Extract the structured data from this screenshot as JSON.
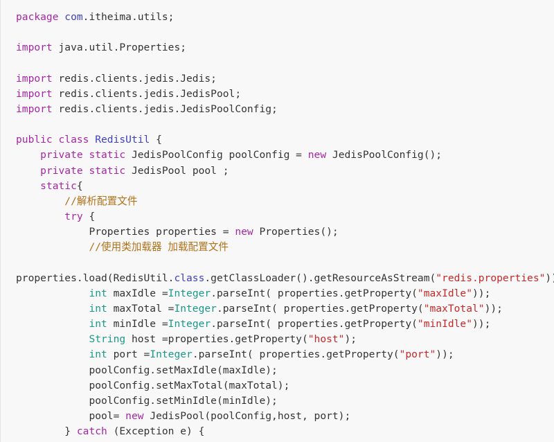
{
  "editor": {
    "language": "java",
    "background_color": "#f8f8f8",
    "text_color": "#333333",
    "theme_colors": {
      "keyword": "#a626a4",
      "type": "#1a9988",
      "class_name": "#4040c0",
      "string": "#c62828",
      "comment": "#b07219",
      "plain": "#333333"
    }
  },
  "code": {
    "lines": [
      {
        "indent": 0,
        "tokens": [
          {
            "t": "package ",
            "c": "kw"
          },
          {
            "t": "com",
            "c": "cls"
          },
          {
            "t": ".itheima.utils;",
            "c": "pln"
          }
        ]
      },
      {
        "indent": 0,
        "tokens": []
      },
      {
        "indent": 0,
        "tokens": [
          {
            "t": "import ",
            "c": "kw"
          },
          {
            "t": "java.util.Properties;",
            "c": "pln"
          }
        ]
      },
      {
        "indent": 0,
        "tokens": []
      },
      {
        "indent": 0,
        "tokens": [
          {
            "t": "import ",
            "c": "kw"
          },
          {
            "t": "redis.clients.jedis.Jedis;",
            "c": "pln"
          }
        ]
      },
      {
        "indent": 0,
        "tokens": [
          {
            "t": "import ",
            "c": "kw"
          },
          {
            "t": "redis.clients.jedis.JedisPool;",
            "c": "pln"
          }
        ]
      },
      {
        "indent": 0,
        "tokens": [
          {
            "t": "import ",
            "c": "kw"
          },
          {
            "t": "redis.clients.jedis.JedisPoolConfig;",
            "c": "pln"
          }
        ]
      },
      {
        "indent": 0,
        "tokens": []
      },
      {
        "indent": 0,
        "tokens": [
          {
            "t": "public class ",
            "c": "kw"
          },
          {
            "t": "RedisUtil",
            "c": "cls"
          },
          {
            "t": " {",
            "c": "pln"
          }
        ]
      },
      {
        "indent": 1,
        "tokens": [
          {
            "t": "private static ",
            "c": "kw"
          },
          {
            "t": "JedisPoolConfig poolConfig = ",
            "c": "pln"
          },
          {
            "t": "new ",
            "c": "kw"
          },
          {
            "t": "JedisPoolConfig();",
            "c": "pln"
          }
        ]
      },
      {
        "indent": 1,
        "tokens": [
          {
            "t": "private static ",
            "c": "kw"
          },
          {
            "t": "JedisPool pool ;",
            "c": "pln"
          }
        ]
      },
      {
        "indent": 1,
        "tokens": [
          {
            "t": "static",
            "c": "kw"
          },
          {
            "t": "{",
            "c": "pln"
          }
        ]
      },
      {
        "indent": 2,
        "tokens": [
          {
            "t": "//解析配置文件",
            "c": "cmt"
          }
        ]
      },
      {
        "indent": 2,
        "tokens": [
          {
            "t": "try ",
            "c": "kw"
          },
          {
            "t": "{",
            "c": "pln"
          }
        ]
      },
      {
        "indent": 3,
        "tokens": [
          {
            "t": "Properties properties = ",
            "c": "pln"
          },
          {
            "t": "new ",
            "c": "kw"
          },
          {
            "t": "Properties();",
            "c": "pln"
          }
        ]
      },
      {
        "indent": 3,
        "tokens": [
          {
            "t": "//使用类加载器 加载配置文件",
            "c": "cmt"
          }
        ]
      },
      {
        "indent": 0,
        "tokens": []
      },
      {
        "indent": 0,
        "tokens": [
          {
            "t": "properties.load(RedisUtil.",
            "c": "pln"
          },
          {
            "t": "class",
            "c": "cls"
          },
          {
            "t": ".getClassLoader().getResourceAsStream(",
            "c": "pln"
          },
          {
            "t": "\"redis.properties\"",
            "c": "str"
          },
          {
            "t": "));",
            "c": "pln"
          }
        ]
      },
      {
        "indent": 3,
        "tokens": [
          {
            "t": "int",
            "c": "typ"
          },
          {
            "t": " maxIdle =",
            "c": "pln"
          },
          {
            "t": "Integer",
            "c": "typ"
          },
          {
            "t": ".parseInt( properties.getProperty(",
            "c": "pln"
          },
          {
            "t": "\"maxIdle\"",
            "c": "str"
          },
          {
            "t": "));",
            "c": "pln"
          }
        ]
      },
      {
        "indent": 3,
        "tokens": [
          {
            "t": "int",
            "c": "typ"
          },
          {
            "t": " maxTotal =",
            "c": "pln"
          },
          {
            "t": "Integer",
            "c": "typ"
          },
          {
            "t": ".parseInt( properties.getProperty(",
            "c": "pln"
          },
          {
            "t": "\"maxTotal\"",
            "c": "str"
          },
          {
            "t": "));",
            "c": "pln"
          }
        ]
      },
      {
        "indent": 3,
        "tokens": [
          {
            "t": "int",
            "c": "typ"
          },
          {
            "t": " minIdle =",
            "c": "pln"
          },
          {
            "t": "Integer",
            "c": "typ"
          },
          {
            "t": ".parseInt( properties.getProperty(",
            "c": "pln"
          },
          {
            "t": "\"minIdle\"",
            "c": "str"
          },
          {
            "t": "));",
            "c": "pln"
          }
        ]
      },
      {
        "indent": 3,
        "tokens": [
          {
            "t": "String",
            "c": "typ"
          },
          {
            "t": " host =properties.getProperty(",
            "c": "pln"
          },
          {
            "t": "\"host\"",
            "c": "str"
          },
          {
            "t": ");",
            "c": "pln"
          }
        ]
      },
      {
        "indent": 3,
        "tokens": [
          {
            "t": "int",
            "c": "typ"
          },
          {
            "t": " port =",
            "c": "pln"
          },
          {
            "t": "Integer",
            "c": "typ"
          },
          {
            "t": ".parseInt( properties.getProperty(",
            "c": "pln"
          },
          {
            "t": "\"port\"",
            "c": "str"
          },
          {
            "t": "));",
            "c": "pln"
          }
        ]
      },
      {
        "indent": 3,
        "tokens": [
          {
            "t": "poolConfig.setMaxIdle(maxIdle);",
            "c": "pln"
          }
        ]
      },
      {
        "indent": 3,
        "tokens": [
          {
            "t": "poolConfig.setMaxTotal(maxTotal);",
            "c": "pln"
          }
        ]
      },
      {
        "indent": 3,
        "tokens": [
          {
            "t": "poolConfig.setMinIdle(minIdle);",
            "c": "pln"
          }
        ]
      },
      {
        "indent": 3,
        "tokens": [
          {
            "t": "pool= ",
            "c": "pln"
          },
          {
            "t": "new ",
            "c": "kw"
          },
          {
            "t": "JedisPool(poolConfig,host, port);",
            "c": "pln"
          }
        ]
      },
      {
        "indent": 2,
        "tokens": [
          {
            "t": "} ",
            "c": "pln"
          },
          {
            "t": "catch ",
            "c": "kw"
          },
          {
            "t": "(Exception e) {",
            "c": "pln"
          }
        ]
      }
    ]
  }
}
